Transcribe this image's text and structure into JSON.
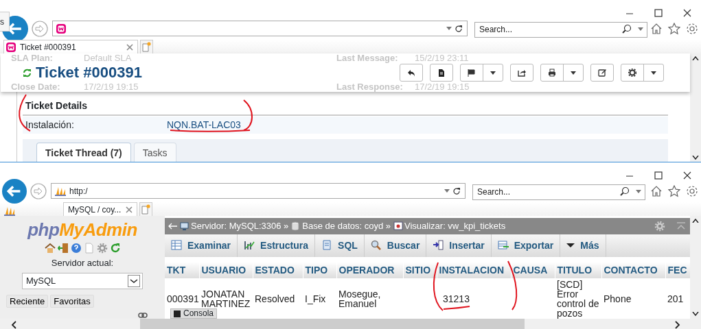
{
  "top_window": {
    "tooltip_fragment": "s",
    "search": {
      "placeholder": "Search..."
    },
    "tab": {
      "title": "Ticket #000391"
    },
    "ticket": {
      "title": "Ticket #000391",
      "background_fields": [
        {
          "label": "SLA Plan:",
          "value": "Default SLA"
        },
        {
          "label": "Close Date:",
          "value": "17/2/19 19:15"
        },
        {
          "label": "Last Message:",
          "value": "15/2/19 23:11"
        },
        {
          "label": "Last Response:",
          "value": "17/2/19 19:15"
        }
      ],
      "toolbar": [
        {
          "dropdown": false
        },
        {
          "dropdown": false
        },
        {
          "dropdown": true
        },
        {
          "dropdown": false
        },
        {
          "dropdown": true
        },
        {
          "dropdown": false
        },
        {
          "dropdown": true
        }
      ],
      "details_heading": "Ticket Details",
      "fields": [
        {
          "label": "Instalación:",
          "value": "NQN.BAT-LAC03"
        }
      ],
      "tabs": [
        {
          "label": "Ticket Thread (7)",
          "selected": true
        },
        {
          "label": "Tasks",
          "selected": false
        }
      ]
    }
  },
  "bottom_window": {
    "address": "http:/",
    "search": {
      "placeholder": "Search..."
    },
    "tab": {
      "title": "MySQL / coy..."
    },
    "sidebar": {
      "logo": {
        "part_1": "php",
        "part_2": "MyAdmin"
      },
      "server_label": "Servidor actual:",
      "server_select": "MySQL",
      "buttons": [
        "Reciente",
        "Favoritas"
      ]
    },
    "breadcrumb": [
      "Servidor: MySQL:3306 »",
      "Base de datos: coyd »",
      "Visualizar: vw_kpi_tickets"
    ],
    "tabs": [
      "Examinar",
      "Estructura",
      "SQL",
      "Buscar",
      "Insertar",
      "Exportar",
      "Más"
    ],
    "table": {
      "columns": [
        "TKT",
        "USUARIO",
        "ESTADO",
        "TIPO",
        "OPERADOR",
        "SITIO",
        "INSTALACION",
        "CAUSA",
        "TITULO",
        "CONTACTO",
        "FEC"
      ],
      "rows": [
        [
          "000391",
          "JONATAN MARTINEZ",
          "Resolved",
          "I_Fix",
          "Mosegue, Emanuel",
          "",
          "31213",
          "",
          "[SCD] Error control de pozos",
          "Phone",
          "201"
        ]
      ]
    },
    "console": "Consola"
  }
}
